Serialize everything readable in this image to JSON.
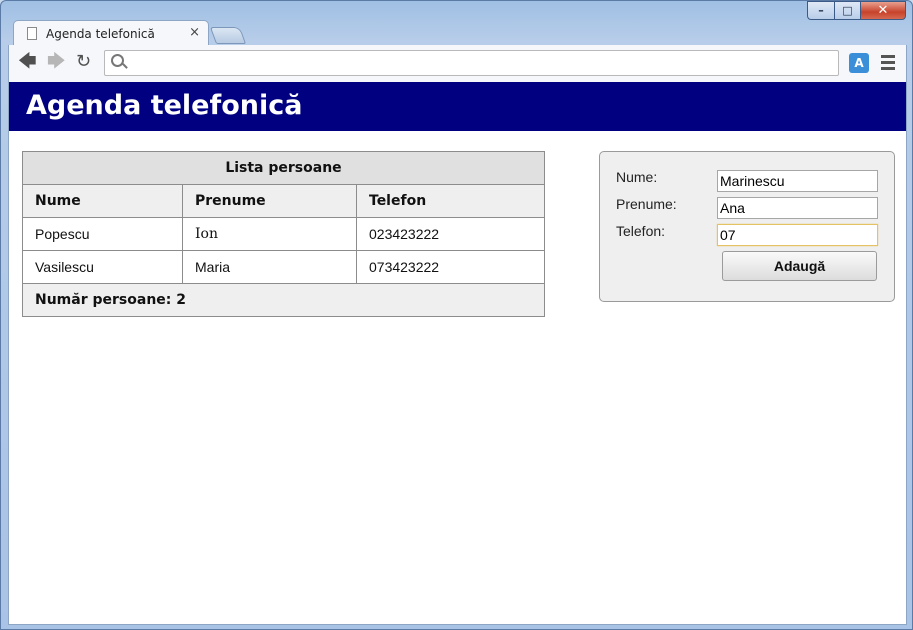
{
  "browser": {
    "tab_title": "Agenda telefonică",
    "tab_close": "×",
    "address_value": "",
    "controls": {
      "minimize": "–",
      "maximize": "□",
      "close": "✕"
    },
    "icons": {
      "back": "arrow-left-icon",
      "forward": "arrow-right-icon",
      "reload": "reload-icon",
      "search": "search-icon",
      "translate": "translate-icon",
      "menu": "hamburger-menu-icon",
      "page": "page-icon"
    }
  },
  "page": {
    "title": "Agenda telefonică",
    "header_bg": "#000080",
    "table": {
      "caption": "Lista persoane",
      "columns": [
        "Nume",
        "Prenume",
        "Telefon"
      ],
      "rows": [
        [
          "Popescu",
          "Ion",
          "023423222"
        ],
        [
          "Vasilescu",
          "Maria",
          "073423222"
        ]
      ],
      "footer": "Număr persoane: 2"
    },
    "form": {
      "nume_label": "Nume:",
      "nume_value": "Marinescu",
      "prenume_label": "Prenume:",
      "prenume_value": "Ana",
      "telefon_label": "Telefon:",
      "telefon_value": "07",
      "submit_label": "Adaugă"
    }
  }
}
